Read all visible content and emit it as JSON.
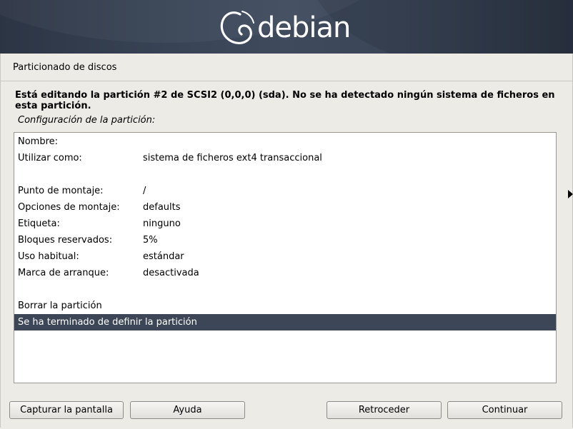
{
  "header": {
    "logo_text": "debian"
  },
  "window": {
    "title": "Particionado de discos"
  },
  "description": "Está editando la partición #2 de SCSI2 (0,0,0) (sda). No se ha detectado ningún sistema de ficheros en esta partición.",
  "subtitle": "Configuración de la partición:",
  "settings": {
    "name_label": "Nombre:",
    "use_as_label": "Utilizar como:",
    "use_as_value": "sistema de ficheros ext4 transaccional",
    "mount_point_label": "Punto de montaje:",
    "mount_point_value": "/",
    "mount_options_label": "Opciones de montaje:",
    "mount_options_value": "defaults",
    "label_label": "Etiqueta:",
    "label_value": "ninguno",
    "reserved_blocks_label": "Bloques reservados:",
    "reserved_blocks_value": "5%",
    "typical_usage_label": "Uso habitual:",
    "typical_usage_value": "estándar",
    "bootable_flag_label": "Marca de arranque:",
    "bootable_flag_value": "desactivada",
    "delete_partition": "Borrar la partición",
    "done_setting_up": "Se ha terminado de definir la partición"
  },
  "buttons": {
    "screenshot": "Capturar la pantalla",
    "help": "Ayuda",
    "back": "Retroceder",
    "continue": "Continuar"
  },
  "colors": {
    "selection": "#3d4656",
    "background": "#edebe6",
    "banner": "#3a4658"
  }
}
